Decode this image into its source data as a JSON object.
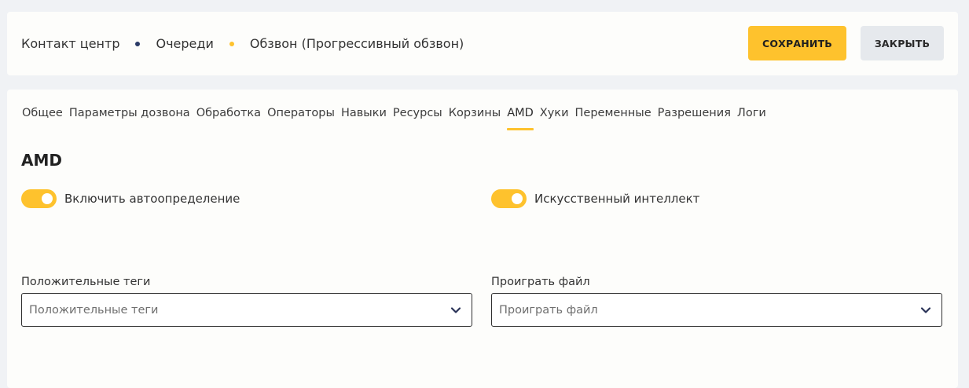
{
  "header": {
    "breadcrumb": [
      {
        "label": "Контакт центр",
        "dot_color": "#2b3a67"
      },
      {
        "label": "Очереди",
        "dot_color": "#fec22d"
      },
      {
        "label": "Обзвон (Прогрессивный обзвон)"
      }
    ],
    "save_label": "СОХРАНИТЬ",
    "close_label": "ЗАКРЫТЬ"
  },
  "tabs": [
    {
      "label": "Общее"
    },
    {
      "label": "Параметры дозвона"
    },
    {
      "label": "Обработка"
    },
    {
      "label": "Операторы"
    },
    {
      "label": "Навыки"
    },
    {
      "label": "Ресурсы"
    },
    {
      "label": "Корзины"
    },
    {
      "label": "AMD",
      "active": true
    },
    {
      "label": "Хуки"
    },
    {
      "label": "Переменные"
    },
    {
      "label": "Разрешения"
    },
    {
      "label": "Логи"
    }
  ],
  "amd": {
    "title": "AMD",
    "toggle_autodetect": {
      "label": "Включить автоопределение",
      "on": true
    },
    "toggle_ai": {
      "label": "Искусственный интеллект",
      "on": true
    },
    "positive_tags": {
      "label": "Положительные теги",
      "placeholder": "Положительные теги"
    },
    "play_file": {
      "label": "Проиграть файл",
      "placeholder": "Проиграть файл"
    }
  },
  "colors": {
    "accent": "#fec22d",
    "dot_dark": "#2b3a67",
    "close_bg": "#e6e9ed"
  }
}
